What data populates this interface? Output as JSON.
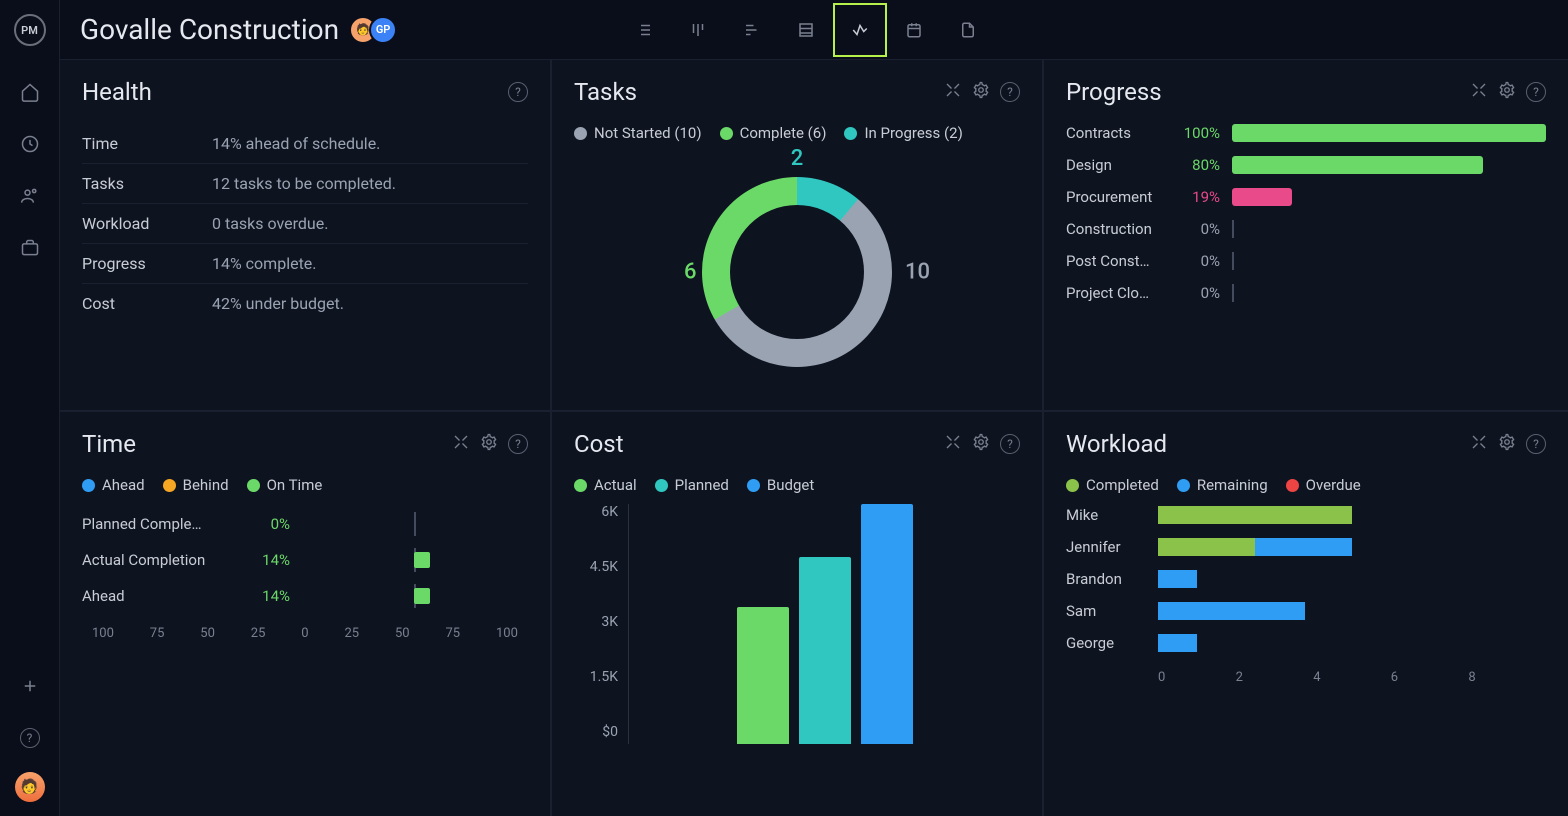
{
  "project_title": "Govalle Construction",
  "avatars": [
    "🧑",
    "GP"
  ],
  "colors": {
    "green": "#6bd968",
    "teal": "#2fc7c0",
    "grey": "#9aa3b2",
    "blue": "#2f9df4",
    "pink": "#e84a8a",
    "lime": "#8bc34a",
    "orange": "#f5a623"
  },
  "panels": {
    "health": {
      "title": "Health",
      "rows": [
        {
          "label": "Time",
          "value": "14% ahead of schedule."
        },
        {
          "label": "Tasks",
          "value": "12 tasks to be completed."
        },
        {
          "label": "Workload",
          "value": "0 tasks overdue."
        },
        {
          "label": "Progress",
          "value": "14% complete."
        },
        {
          "label": "Cost",
          "value": "42% under budget."
        }
      ]
    },
    "tasks": {
      "title": "Tasks",
      "legend": [
        {
          "label": "Not Started (10)",
          "color": "#9aa3b2"
        },
        {
          "label": "Complete (6)",
          "color": "#6bd968"
        },
        {
          "label": "In Progress (2)",
          "color": "#2fc7c0"
        }
      ],
      "donut_labels": {
        "top": "2",
        "left": "6",
        "right": "10"
      }
    },
    "progress": {
      "title": "Progress",
      "rows": [
        {
          "name": "Contracts",
          "pct": "100%",
          "pct_num": 100,
          "color": "#6bd968"
        },
        {
          "name": "Design",
          "pct": "80%",
          "pct_num": 80,
          "color": "#6bd968"
        },
        {
          "name": "Procurement",
          "pct": "19%",
          "pct_num": 19,
          "color": "#e84a8a"
        },
        {
          "name": "Construction",
          "pct": "0%",
          "pct_num": 0,
          "color": "#9aa3b2"
        },
        {
          "name": "Post Const…",
          "pct": "0%",
          "pct_num": 0,
          "color": "#9aa3b2"
        },
        {
          "name": "Project Clo…",
          "pct": "0%",
          "pct_num": 0,
          "color": "#9aa3b2"
        }
      ]
    },
    "time": {
      "title": "Time",
      "legend": [
        {
          "label": "Ahead",
          "color": "#2f9df4"
        },
        {
          "label": "Behind",
          "color": "#f5a623"
        },
        {
          "label": "On Time",
          "color": "#6bd968"
        }
      ],
      "rows": [
        {
          "name": "Planned Comple…",
          "pct": "0%",
          "bar": 0
        },
        {
          "name": "Actual Completion",
          "pct": "14%",
          "bar": 14
        },
        {
          "name": "Ahead",
          "pct": "14%",
          "bar": 14
        }
      ],
      "axis": [
        "100",
        "75",
        "50",
        "25",
        "0",
        "25",
        "50",
        "75",
        "100"
      ]
    },
    "cost": {
      "title": "Cost",
      "legend": [
        {
          "label": "Actual",
          "color": "#6bd968"
        },
        {
          "label": "Planned",
          "color": "#2fc7c0"
        },
        {
          "label": "Budget",
          "color": "#2f9df4"
        }
      ],
      "yaxis": [
        "6K",
        "4.5K",
        "3K",
        "1.5K",
        "$0"
      ],
      "bars": [
        {
          "h": 57,
          "color": "#6bd968"
        },
        {
          "h": 78,
          "color": "#2fc7c0"
        },
        {
          "h": 100,
          "color": "#2f9df4"
        }
      ]
    },
    "workload": {
      "title": "Workload",
      "legend": [
        {
          "label": "Completed",
          "color": "#8bc34a"
        },
        {
          "label": "Remaining",
          "color": "#2f9df4"
        },
        {
          "label": "Overdue",
          "color": "#ef4444"
        }
      ],
      "rows": [
        {
          "name": "Mike",
          "segs": [
            {
              "w": 50,
              "c": "#8bc34a"
            }
          ]
        },
        {
          "name": "Jennifer",
          "segs": [
            {
              "w": 25,
              "c": "#8bc34a"
            },
            {
              "w": 25,
              "c": "#2f9df4"
            }
          ]
        },
        {
          "name": "Brandon",
          "segs": [
            {
              "w": 10,
              "c": "#2f9df4"
            }
          ]
        },
        {
          "name": "Sam",
          "segs": [
            {
              "w": 38,
              "c": "#2f9df4"
            }
          ]
        },
        {
          "name": "George",
          "segs": [
            {
              "w": 10,
              "c": "#2f9df4"
            }
          ]
        }
      ],
      "axis": [
        "0",
        "2",
        "4",
        "6",
        "8"
      ]
    }
  },
  "chart_data": [
    {
      "type": "pie",
      "title": "Tasks",
      "series": [
        {
          "name": "Not Started",
          "value": 10
        },
        {
          "name": "Complete",
          "value": 6
        },
        {
          "name": "In Progress",
          "value": 2
        }
      ]
    },
    {
      "type": "bar",
      "title": "Progress",
      "orientation": "horizontal",
      "categories": [
        "Contracts",
        "Design",
        "Procurement",
        "Construction",
        "Post Construction",
        "Project Closure"
      ],
      "values": [
        100,
        80,
        19,
        0,
        0,
        0
      ],
      "ylabel": "% complete",
      "ylim": [
        0,
        100
      ]
    },
    {
      "type": "bar",
      "title": "Time",
      "orientation": "horizontal",
      "categories": [
        "Planned Completion",
        "Actual Completion",
        "Ahead"
      ],
      "values": [
        0,
        14,
        14
      ],
      "xlim": [
        -100,
        100
      ],
      "xlabel": "%"
    },
    {
      "type": "bar",
      "title": "Cost",
      "categories": [
        "Actual",
        "Planned",
        "Budget"
      ],
      "values": [
        3400,
        4700,
        6000
      ],
      "ylabel": "$",
      "ylim": [
        0,
        6000
      ]
    },
    {
      "type": "bar",
      "title": "Workload",
      "orientation": "horizontal",
      "categories": [
        "Mike",
        "Jennifer",
        "Brandon",
        "Sam",
        "George"
      ],
      "series": [
        {
          "name": "Completed",
          "values": [
            4,
            2,
            0,
            0,
            0
          ]
        },
        {
          "name": "Remaining",
          "values": [
            0,
            2,
            1,
            3,
            1
          ]
        },
        {
          "name": "Overdue",
          "values": [
            0,
            0,
            0,
            0,
            0
          ]
        }
      ],
      "xlim": [
        0,
        8
      ]
    }
  ]
}
